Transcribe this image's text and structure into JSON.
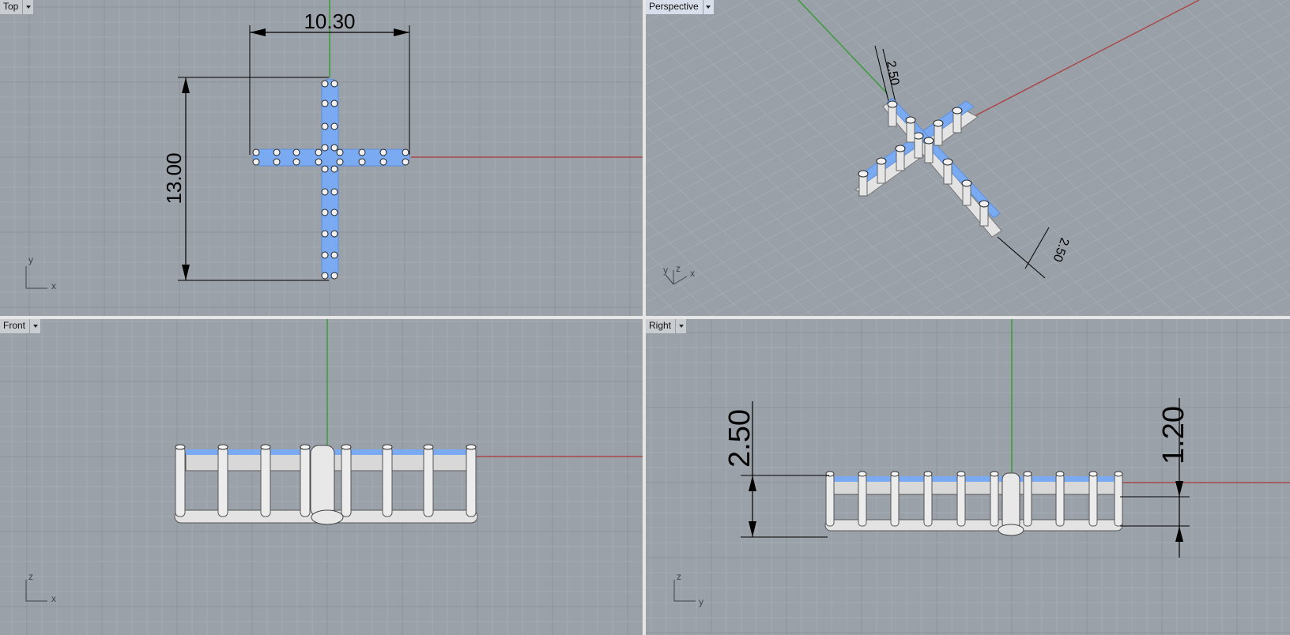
{
  "viewports": {
    "top": {
      "label": "Top"
    },
    "perspective": {
      "label": "Perspective"
    },
    "front": {
      "label": "Front"
    },
    "right": {
      "label": "Right"
    }
  },
  "dimensions": {
    "top_width": "10.30",
    "top_height": "13.00",
    "perspective_height": "2.50",
    "perspective_small": "2.50",
    "right_total": "2.50",
    "right_partial": "1.20"
  },
  "axis_labels": {
    "top": [
      "y",
      "x"
    ],
    "perspective": [
      "y",
      "z",
      "x"
    ],
    "front": [
      "z",
      "x"
    ],
    "right": [
      "z",
      "y"
    ]
  },
  "colors": {
    "viewport_bg": "#9ba1a9",
    "grid_minor": "#a4aab2",
    "grid_major": "#8d939b",
    "x_axis": "#a84848",
    "y_axis": "#3a9a3a",
    "selected": "#7aaaf2",
    "object": "#e3e3e3"
  }
}
